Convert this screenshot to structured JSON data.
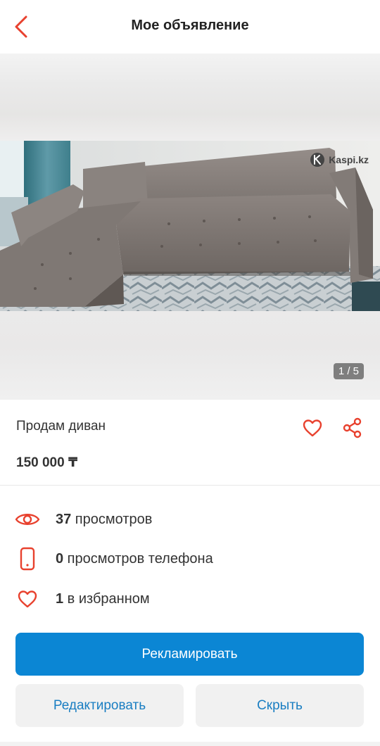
{
  "header": {
    "title": "Мое объявление"
  },
  "photo": {
    "watermark": "Kaspi.kz",
    "counter": "1 / 5"
  },
  "ad": {
    "title": "Продам диван",
    "price": "150 000 ₸"
  },
  "stats": {
    "views": {
      "count": "37",
      "label": " просмотров"
    },
    "phone_views": {
      "count": "0",
      "label": " просмотров телефона"
    },
    "favorites": {
      "count": "1",
      "label": " в избранном"
    }
  },
  "actions": {
    "promote_label": "Рекламировать",
    "edit_label": "Редактировать",
    "hide_label": "Скрыть"
  },
  "colors": {
    "accent_red": "#e8412e",
    "primary_blue": "#0b86d4",
    "link_blue": "#1a7ec2"
  }
}
